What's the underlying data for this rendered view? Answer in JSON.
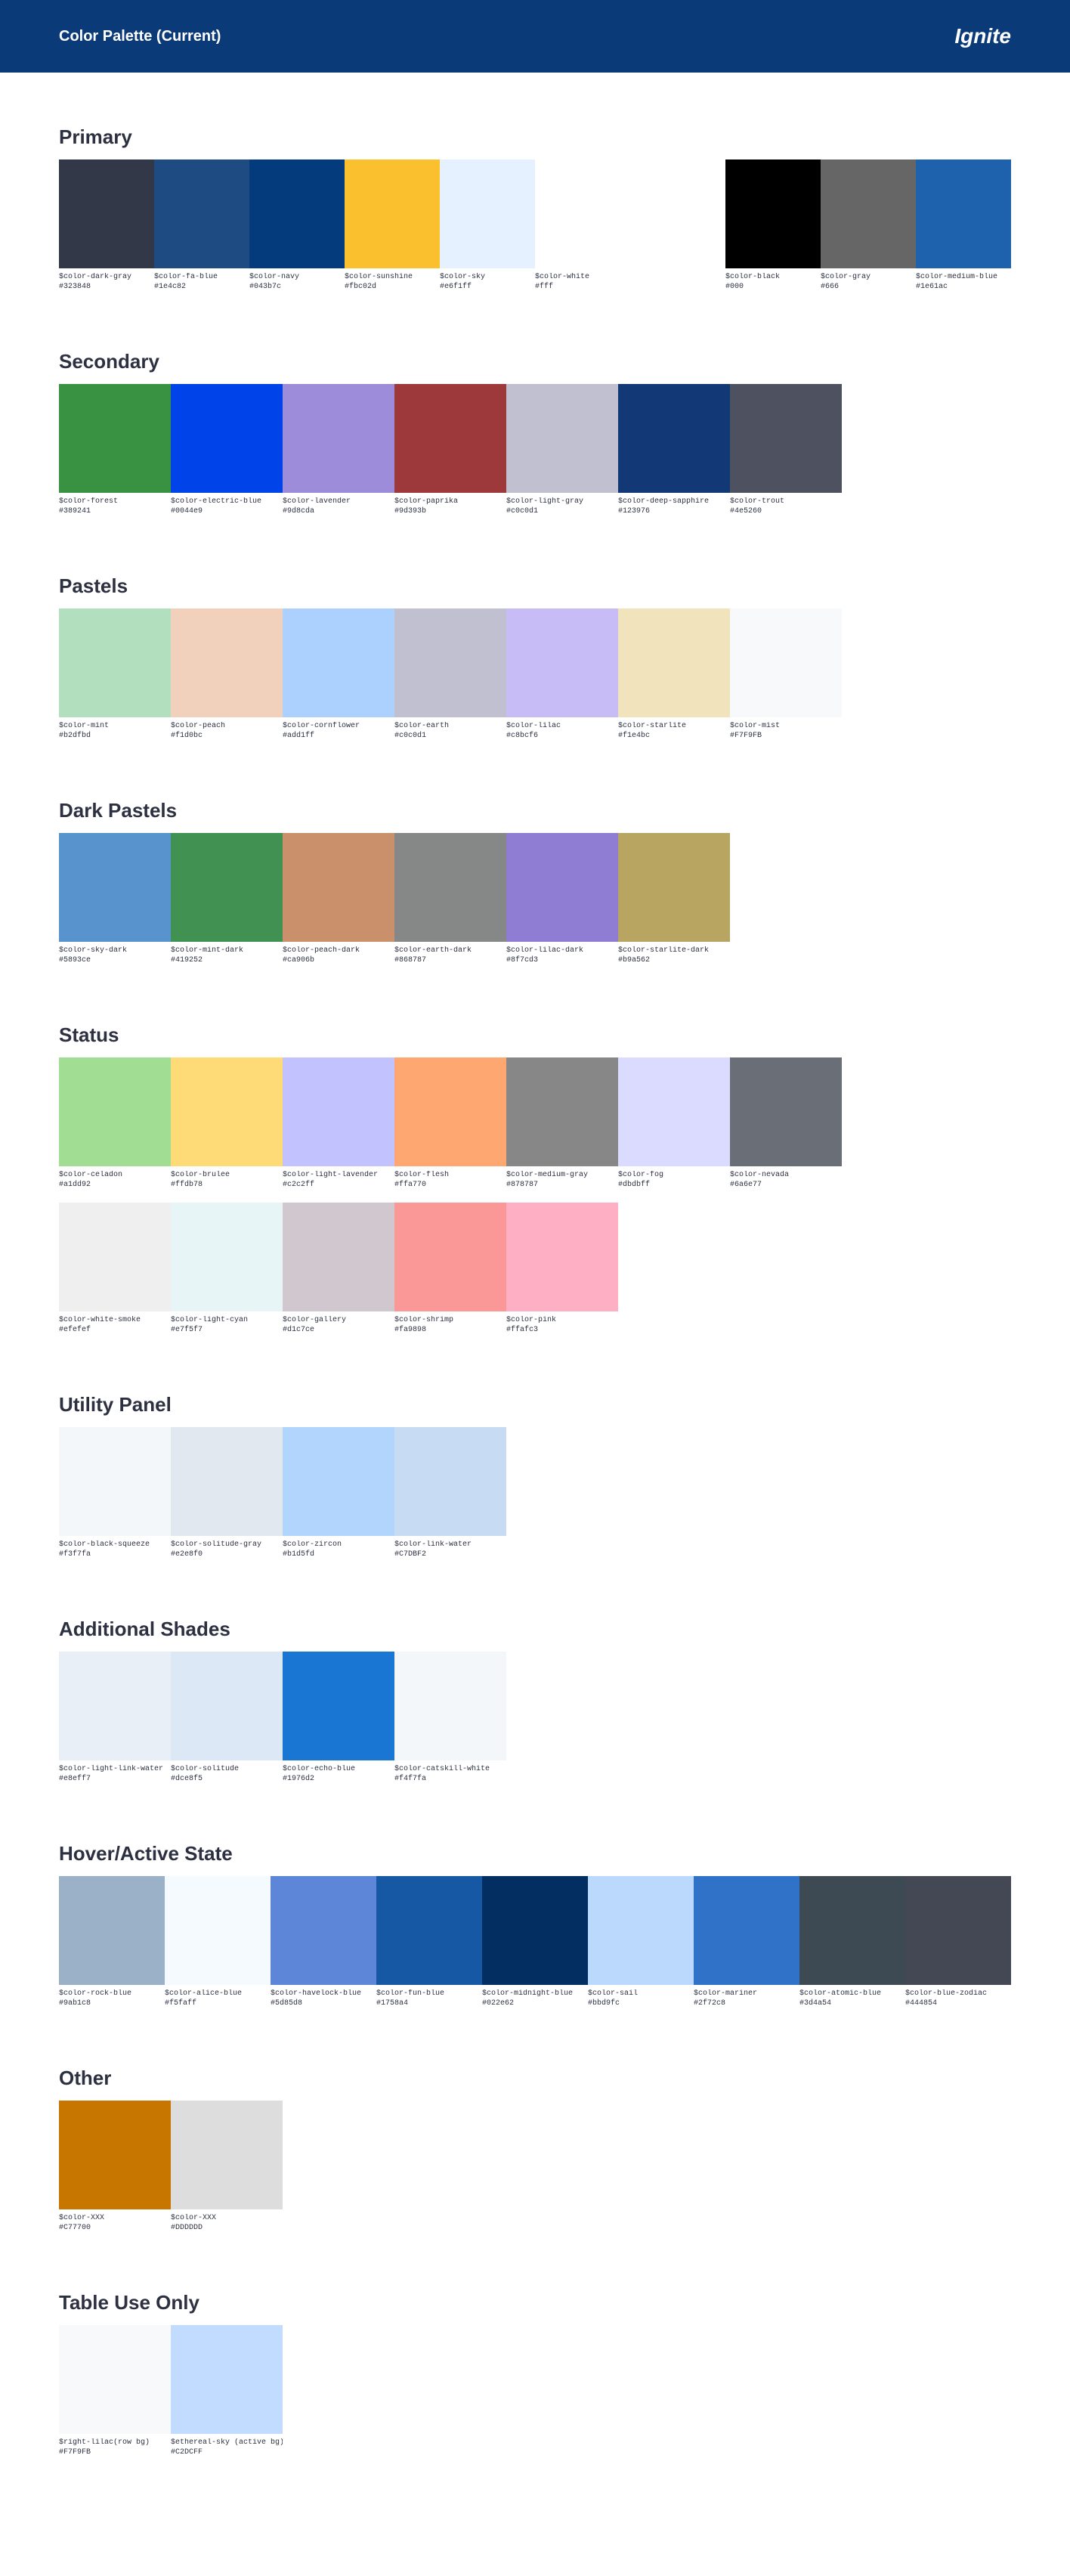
{
  "header": {
    "title": "Color Palette (Current)",
    "brand": "Ignite"
  },
  "sections": {
    "primary": {
      "title": "Primary"
    },
    "secondary": {
      "title": "Secondary"
    },
    "pastels": {
      "title": "Pastels"
    },
    "dark": {
      "title": "Dark Pastels"
    },
    "status": {
      "title": "Status"
    },
    "utility": {
      "title": "Utility Panel"
    },
    "additional": {
      "title": "Additional Shades"
    },
    "hover": {
      "title": "Hover/Active State"
    },
    "other": {
      "title": "Other"
    },
    "table": {
      "title": "Table Use Only"
    }
  },
  "primary": [
    {
      "name": "$color-dark-gray",
      "hex": "#323848",
      "color": "#323848"
    },
    {
      "name": "$color-fa-blue",
      "hex": "#1e4c82",
      "color": "#1e4c82"
    },
    {
      "name": "$color-navy",
      "hex": "#043b7c",
      "color": "#043b7c"
    },
    {
      "name": "$color-sunshine",
      "hex": "#fbc02d",
      "color": "#fbc02d"
    },
    {
      "name": "$color-sky",
      "hex": "#e6f1ff",
      "color": "#e6f1ff"
    },
    {
      "name": "$color-white",
      "hex": "#fff",
      "color": "#ffffff"
    },
    {
      "name": "$color-black",
      "hex": "#000",
      "color": "#000000"
    },
    {
      "name": "$color-gray",
      "hex": "#666",
      "color": "#666666"
    },
    {
      "name": "$color-medium-blue",
      "hex": "#1e61ac",
      "color": "#1e61ac"
    }
  ],
  "secondary": [
    {
      "name": "$color-forest",
      "hex": "#389241",
      "color": "#389241"
    },
    {
      "name": "$color-electric-blue",
      "hex": "#0044e9",
      "color": "#0044e9"
    },
    {
      "name": "$color-lavender",
      "hex": "#9d8cda",
      "color": "#9d8cda"
    },
    {
      "name": "$color-paprika",
      "hex": "#9d393b",
      "color": "#9d393b"
    },
    {
      "name": "$color-light-gray",
      "hex": "#c0c0d1",
      "color": "#c0c0d1"
    },
    {
      "name": "$color-deep-sapphire",
      "hex": "#123976",
      "color": "#123976"
    },
    {
      "name": "$color-trout",
      "hex": "#4e5260",
      "color": "#4e5260"
    }
  ],
  "pastels": [
    {
      "name": "$color-mint",
      "hex": "#b2dfbd",
      "color": "#b2dfbd"
    },
    {
      "name": "$color-peach",
      "hex": "#f1d0bc",
      "color": "#f1d0bc"
    },
    {
      "name": "$color-cornflower",
      "hex": "#add1ff",
      "color": "#add1ff"
    },
    {
      "name": "$color-earth",
      "hex": "#c0c0d1",
      "color": "#c0c0d1"
    },
    {
      "name": "$color-lilac",
      "hex": "#c8bcf6",
      "color": "#c8bcf6"
    },
    {
      "name": "$color-starlite",
      "hex": "#f1e4bc",
      "color": "#f1e4bc"
    },
    {
      "name": "$color-mist",
      "hex": "#F7F9FB",
      "color": "#F7F9FB"
    }
  ],
  "dark": [
    {
      "name": "$color-sky-dark",
      "hex": "#5893ce",
      "color": "#5893ce"
    },
    {
      "name": "$color-mint-dark",
      "hex": "#419252",
      "color": "#419252"
    },
    {
      "name": "$color-peach-dark",
      "hex": "#ca906b",
      "color": "#ca906b"
    },
    {
      "name": "$color-earth-dark",
      "hex": "#868787",
      "color": "#868787"
    },
    {
      "name": "$color-lilac-dark",
      "hex": "#8f7cd3",
      "color": "#8f7cd3"
    },
    {
      "name": "$color-starlite-dark",
      "hex": "#b9a562",
      "color": "#b9a562"
    }
  ],
  "status": [
    {
      "name": "$color-celadon",
      "hex": "#a1dd92",
      "color": "#a1dd92"
    },
    {
      "name": "$color-brulee",
      "hex": "#ffdb78",
      "color": "#ffdb78"
    },
    {
      "name": "$color-light-lavender",
      "hex": "#c2c2ff",
      "color": "#c2c2ff"
    },
    {
      "name": "$color-flesh",
      "hex": "#ffa770",
      "color": "#ffa770"
    },
    {
      "name": "$color-medium-gray",
      "hex": "#878787",
      "color": "#878787"
    },
    {
      "name": "$color-fog",
      "hex": "#dbdbff",
      "color": "#dbdbff"
    },
    {
      "name": "$color-nevada",
      "hex": "#6a6e77",
      "color": "#6a6e77"
    },
    {
      "name": "$color-white-smoke",
      "hex": "#efefef",
      "color": "#efefef"
    },
    {
      "name": "$color-light-cyan",
      "hex": "#e7f5f7",
      "color": "#e7f5f7"
    },
    {
      "name": "$color-gallery",
      "hex": "#d1c7ce",
      "color": "#d1c7ce"
    },
    {
      "name": "$color-shrimp",
      "hex": "#fa9898",
      "color": "#fa9898"
    },
    {
      "name": "$color-pink",
      "hex": "#ffafc3",
      "color": "#ffafc3"
    }
  ],
  "utility": [
    {
      "name": "$color-black-squeeze",
      "hex": "#f3f7fa",
      "color": "#f3f7fa"
    },
    {
      "name": "$color-solitude-gray",
      "hex": "#e2e8f0",
      "color": "#e2e8f0"
    },
    {
      "name": "$color-zircon",
      "hex": "#b1d5fd",
      "color": "#b1d5fd"
    },
    {
      "name": "$color-link-water",
      "hex": "#C7DBF2",
      "color": "#C7DBF2"
    }
  ],
  "additional": [
    {
      "name": "$color-light-link-water",
      "hex": "#e8eff7",
      "color": "#e8eff7"
    },
    {
      "name": "$color-solitude",
      "hex": "#dce8f5",
      "color": "#dce8f5"
    },
    {
      "name": "$color-echo-blue",
      "hex": "#1976d2",
      "color": "#1976d2"
    },
    {
      "name": "$color-catskill-white",
      "hex": "#f4f7fa",
      "color": "#f4f7fa"
    }
  ],
  "hover": [
    {
      "name": "$color-rock-blue",
      "hex": "#9ab1c8",
      "color": "#9ab1c8"
    },
    {
      "name": "$color-alice-blue",
      "hex": "#f5faff",
      "color": "#f5faff"
    },
    {
      "name": "$color-havelock-blue",
      "hex": "#5d85d8",
      "color": "#5d85d8"
    },
    {
      "name": "$color-fun-blue",
      "hex": "#1758a4",
      "color": "#1758a4"
    },
    {
      "name": "$color-midnight-blue",
      "hex": "#022e62",
      "color": "#022e62"
    },
    {
      "name": "$color-sail",
      "hex": "#bbd9fc",
      "color": "#bbd9fc"
    },
    {
      "name": "$color-mariner",
      "hex": "#2f72c8",
      "color": "#2f72c8"
    },
    {
      "name": "$color-atomic-blue",
      "hex": "#3d4a54",
      "color": "#3d4a54"
    },
    {
      "name": "$color-blue-zodiac",
      "hex": "#444854",
      "color": "#444854"
    }
  ],
  "other": [
    {
      "name": "$color-XXX",
      "hex": "#C77700",
      "color": "#C77700"
    },
    {
      "name": "$color-XXX",
      "hex": "#DDDDDD",
      "color": "#DDDDDD"
    }
  ],
  "table": [
    {
      "name": "$right-lilac(row bg)",
      "hex": "#F7F9FB",
      "color": "#F7F9FB"
    },
    {
      "name": "$ethereal-sky (active bg)",
      "hex": "#C2DCFF",
      "color": "#C2DCFF"
    }
  ]
}
